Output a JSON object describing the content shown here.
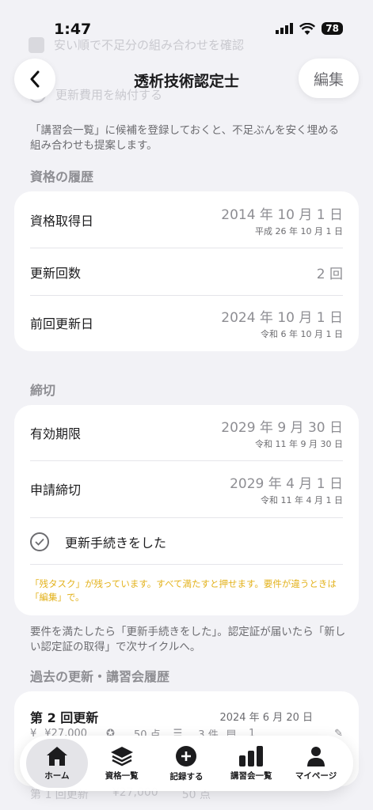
{
  "status_bar": {
    "time": "1:47",
    "battery": "78"
  },
  "nav": {
    "title": "透析技術認定士",
    "edit_label": "編集"
  },
  "ghost": {
    "row1": "安い順で不足分の組み合わせを確認",
    "row2": "更新費用を納付する"
  },
  "intro_note": "「講習会一覧」に候補を登録しておくと、不足ぶんを安く埋める組み合わせも提案します。",
  "history": {
    "heading": "資格の履歴",
    "rows": [
      {
        "label": "資格取得日",
        "value": "2014 年 10 月 1 日",
        "sub": "平成 26 年 10 月 1 日"
      },
      {
        "label": "更新回数",
        "value": "2 回",
        "sub": ""
      },
      {
        "label": "前回更新日",
        "value": "2024 年 10 月 1 日",
        "sub": "令和 6 年 10 月 1 日"
      }
    ]
  },
  "deadline": {
    "heading": "締切",
    "rows": [
      {
        "label": "有効期限",
        "value": "2029 年 9 月 30 日",
        "sub": "令和 11 年 9 月 30 日"
      },
      {
        "label": "申請締切",
        "value": "2029 年 4 月 1 日",
        "sub": "令和 11 年 4 月 1 日"
      }
    ],
    "done_label": "更新手続きをした",
    "warning": "「残タスク」が残っています。すべて満たすと押せます。要件が違うときは「編集」で。"
  },
  "cycle_note": "要件を満たしたら「更新手続きをした」。認定証が届いたら「新しい認定証の取得」で次サイクルへ。",
  "past": {
    "heading": "過去の更新・講習会履歴",
    "item": {
      "title": "第 2 回更新",
      "date": "2024 年 6 月 20 日",
      "cost": "¥27,000",
      "points": "50 点",
      "count": "3 件",
      "docs": "1"
    },
    "ghost_next": {
      "title": "第 1 回更新",
      "cost": "¥27,000",
      "points": "50 点"
    }
  },
  "tabs": [
    {
      "label": "ホーム",
      "icon": "home-icon"
    },
    {
      "label": "資格一覧",
      "icon": "layers-icon"
    },
    {
      "label": "記録する",
      "icon": "plus-circle-icon"
    },
    {
      "label": "講習会一覧",
      "icon": "bar-chart-icon"
    },
    {
      "label": "マイページ",
      "icon": "person-icon"
    }
  ]
}
